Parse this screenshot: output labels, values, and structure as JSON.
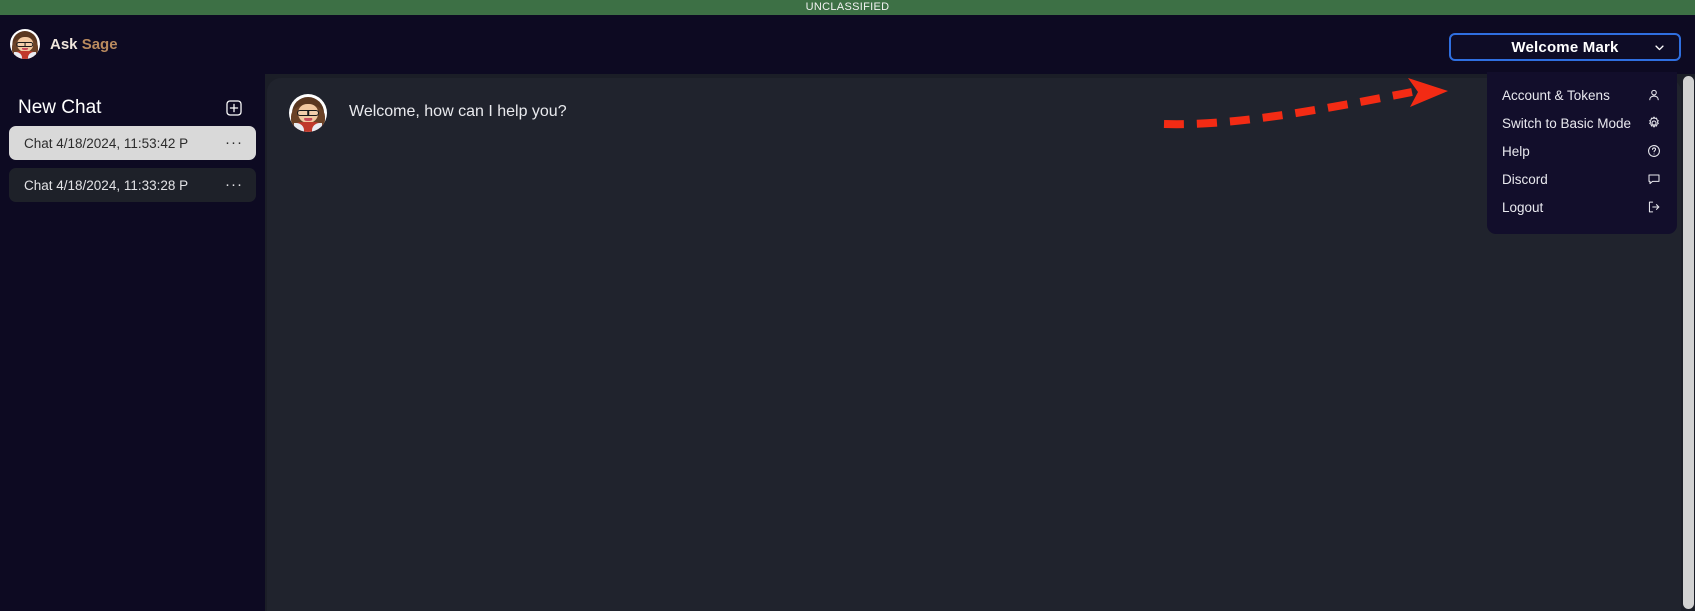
{
  "classification": {
    "banner_text": "UNCLASSIFIED",
    "banner_color": "#3d7045"
  },
  "header": {
    "brand_primary": "Ask",
    "brand_secondary": "Sage",
    "avatar_name": "sage-avatar"
  },
  "user_menu": {
    "button_label": "Welcome Mark",
    "button_border_color": "#2f6fe0",
    "chevron_icon": "chevron-down-icon",
    "expanded": true,
    "items": [
      {
        "label": "Account & Tokens",
        "icon": "user-icon"
      },
      {
        "label": "Switch to Basic Mode",
        "icon": "gear-icon"
      },
      {
        "label": "Help",
        "icon": "help-circle-icon"
      },
      {
        "label": "Discord",
        "icon": "chat-bubble-icon"
      },
      {
        "label": "Logout",
        "icon": "logout-icon"
      }
    ]
  },
  "sidebar": {
    "title": "New Chat",
    "new_chat_icon": "plus-square-icon",
    "chats": [
      {
        "label": "Chat 4/18/2024, 11:53:42 P",
        "more": "···",
        "active": true
      },
      {
        "label": "Chat 4/18/2024, 11:33:28 P",
        "more": "···",
        "active": false
      }
    ]
  },
  "main": {
    "messages": [
      {
        "author_avatar": "sage-avatar",
        "text": "Welcome, how can I help you?"
      }
    ]
  },
  "annotation": {
    "type": "dashed-arrow",
    "color": "#f32b14",
    "points_to": "user-menu-first-item"
  }
}
